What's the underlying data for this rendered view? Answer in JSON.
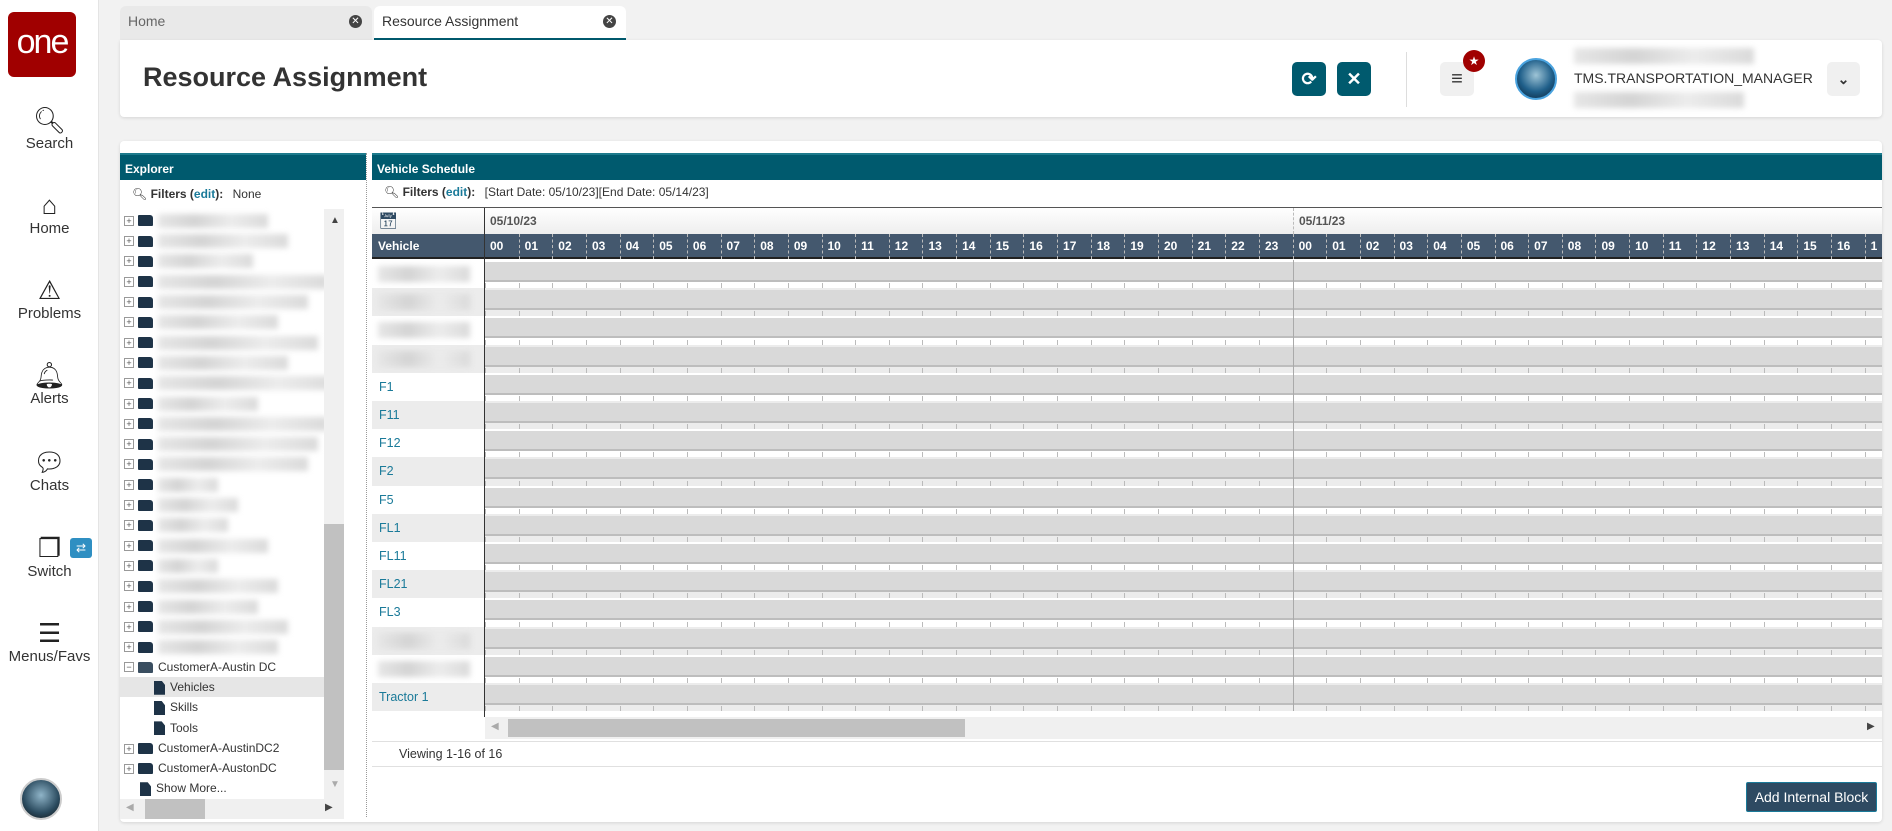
{
  "app": {
    "logo": "one",
    "user_role": "TMS.TRANSPORTATION_MANAGER"
  },
  "sidebar": {
    "items": [
      {
        "label": "Search",
        "icon": "search-icon",
        "glyph": "🔍︎"
      },
      {
        "label": "Home",
        "icon": "home-icon",
        "glyph": "⌂"
      },
      {
        "label": "Problems",
        "icon": "warning-icon",
        "glyph": "⚠"
      },
      {
        "label": "Alerts",
        "icon": "bell-icon",
        "glyph": "🔔︎"
      },
      {
        "label": "Chats",
        "icon": "chat-icon",
        "glyph": "💬︎"
      },
      {
        "label": "Switch",
        "icon": "switch-icon",
        "glyph": "❐"
      },
      {
        "label": "Menus/Favs",
        "icon": "menu-icon",
        "glyph": "☰"
      }
    ],
    "switch_badge": "⇄"
  },
  "tabs": [
    {
      "label": "Home",
      "active": false
    },
    {
      "label": "Resource Assignment",
      "active": true
    }
  ],
  "header": {
    "title": "Resource Assignment",
    "refresh": "⟳",
    "close": "✕",
    "menu": "≡",
    "star": "★",
    "chevron": "⌄"
  },
  "explorer": {
    "title": "Explorer",
    "filters_label": "Filters (",
    "filters_edit": "edit",
    "filters_suffix": "):",
    "filters_value": "None",
    "blurred_rows": 22,
    "tree": [
      {
        "label": "CustomerA-Austin DC",
        "type": "folder-open",
        "level": 0
      },
      {
        "label": "Vehicles",
        "type": "doc",
        "level": 1,
        "selected": true
      },
      {
        "label": "Skills",
        "type": "doc",
        "level": 1
      },
      {
        "label": "Tools",
        "type": "doc",
        "level": 1
      },
      {
        "label": "CustomerA-AustinDC2",
        "type": "folder",
        "level": 0
      },
      {
        "label": "CustomerA-AustonDC",
        "type": "folder",
        "level": 0
      },
      {
        "label": "Show More...",
        "type": "doc",
        "level": 0
      }
    ]
  },
  "schedule": {
    "title": "Vehicle Schedule",
    "filters_label": "Filters (",
    "filters_edit": "edit",
    "filters_suffix": "):",
    "filters_value": "[Start Date: 05/10/23][End Date: 05/14/23]",
    "vehicle_header": "Vehicle",
    "dates": [
      "05/10/23",
      "05/11/23"
    ],
    "hours": [
      "00",
      "01",
      "02",
      "03",
      "04",
      "05",
      "06",
      "07",
      "08",
      "09",
      "10",
      "11",
      "12",
      "13",
      "14",
      "15",
      "16",
      "17",
      "18",
      "19",
      "20",
      "21",
      "22",
      "23",
      "00",
      "01",
      "02",
      "03",
      "04",
      "05",
      "06",
      "07",
      "08",
      "09",
      "10",
      "11",
      "12",
      "13",
      "14",
      "15",
      "16",
      "1"
    ],
    "vehicles": [
      "",
      "",
      "",
      "",
      "F1",
      "F11",
      "F12",
      "F2",
      "F5",
      "FL1",
      "FL11",
      "FL21",
      "FL3",
      "",
      "",
      "Tractor 1"
    ],
    "viewing": "Viewing 1-16 of 16",
    "add_button": "Add Internal Block"
  }
}
